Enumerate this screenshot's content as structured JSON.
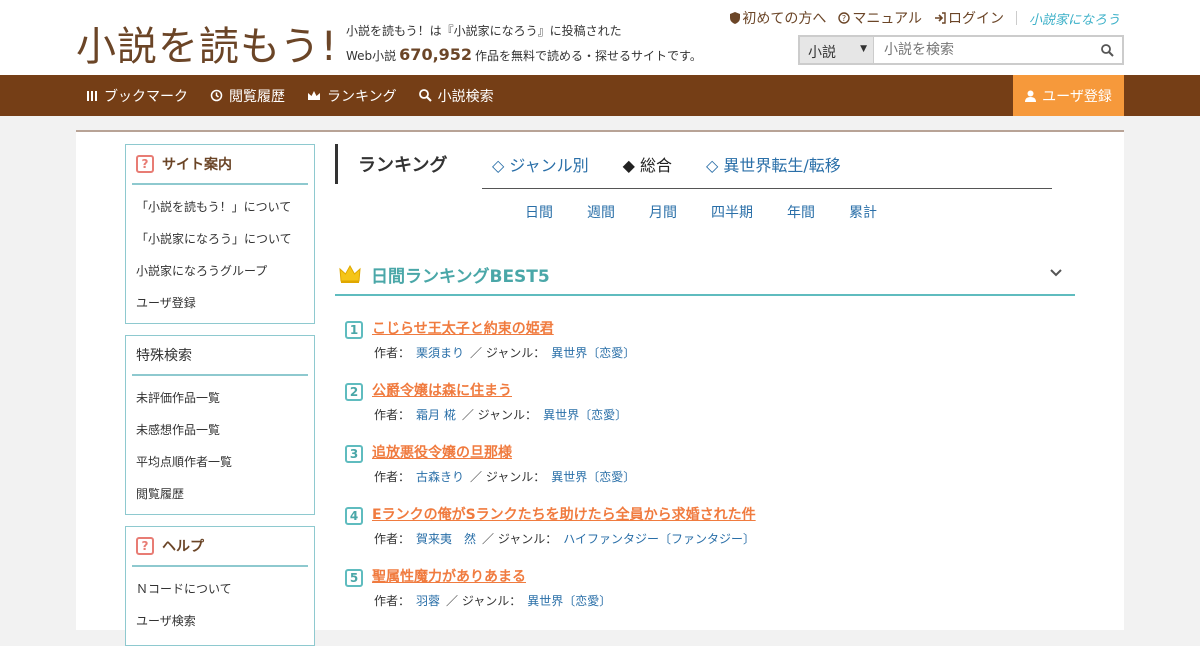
{
  "site": {
    "logo": "小説を読もう!",
    "tagline_line1": "小説を読もう！は『小説家になろう』に投稿された",
    "tagline_prefix": "Web小説",
    "work_count": "670,952",
    "tagline_suffix": "作品を無料で読める・探せるサイトです。"
  },
  "toplinks": {
    "beginner": "初めての方へ",
    "manual": "マニュアル",
    "login": "ログイン",
    "narou": "小説家になろう"
  },
  "search": {
    "select_value": "小説",
    "placeholder": "小説を検索"
  },
  "nav": {
    "items": [
      {
        "label": "ブックマーク"
      },
      {
        "label": "閲覧履歴"
      },
      {
        "label": "ランキング"
      },
      {
        "label": "小説検索"
      }
    ],
    "register": "ユーザ登録"
  },
  "sidebar": {
    "guide": {
      "title": "サイト案内",
      "items": [
        "「小説を読もう！」について",
        "「小説家になろう」について",
        "小説家になろうグループ",
        "ユーザ登録"
      ]
    },
    "special": {
      "title": "特殊検索",
      "items": [
        "未評価作品一覧",
        "未感想作品一覧",
        "平均点順作者一覧",
        "閲覧履歴"
      ]
    },
    "help": {
      "title": "ヘルプ",
      "items": [
        "Ｎコードについて",
        "ユーザ検索"
      ]
    }
  },
  "ranking": {
    "title": "ランキング",
    "tabs": [
      "◇ ジャンル別",
      "◆ 総合",
      "◇ 異世界転生/転移"
    ],
    "periods": [
      "日間",
      "週間",
      "月間",
      "四半期",
      "年間",
      "累計"
    ],
    "best_title": "日間ランキングBEST5",
    "author_label": "作者：",
    "genre_label": "／ ジャンル：",
    "entries": [
      {
        "rank": "1",
        "title": "こじらせ王太子と約束の姫君",
        "author": "栗須まり",
        "genre": "異世界〔恋愛〕"
      },
      {
        "rank": "2",
        "title": "公爵令嬢は森に住まう",
        "author": "霜月 椛",
        "genre": "異世界〔恋愛〕"
      },
      {
        "rank": "3",
        "title": "追放悪役令嬢の旦那様",
        "author": "古森きり",
        "genre": "異世界〔恋愛〕"
      },
      {
        "rank": "4",
        "title": "Eランクの俺がSランクたちを助けたら全員から求婚された件",
        "author": "賀来夷　然",
        "genre": "ハイファンタジー〔ファンタジー〕"
      },
      {
        "rank": "5",
        "title": "聖属性魔力がありあまる",
        "author": "羽蓉",
        "genre": "異世界〔恋愛〕"
      }
    ]
  },
  "colors": {
    "brand_brown": "#753e16",
    "accent_orange": "#f6993b",
    "teal": "#5fbcbf",
    "link_blue": "#2a6fa8",
    "title_orange": "#f07b3f"
  }
}
